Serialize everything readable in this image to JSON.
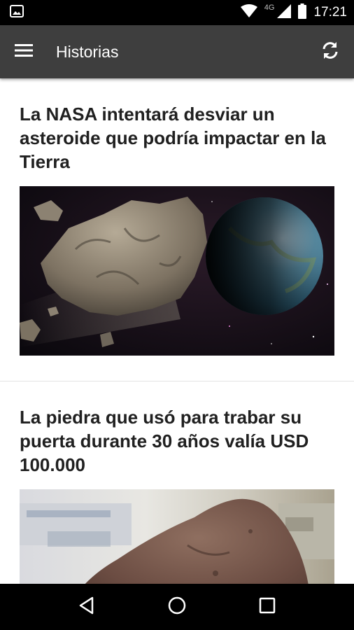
{
  "status_bar": {
    "time": "17:21",
    "network": "4G",
    "icons": [
      "image-notification-icon",
      "wifi-icon",
      "cell-signal-icon",
      "battery-icon"
    ]
  },
  "app_bar": {
    "title": "Historias",
    "menu_icon": "hamburger-menu-icon",
    "refresh_icon": "refresh-icon",
    "background": "#3e3e3e"
  },
  "articles": [
    {
      "title": "La NASA intentará desviar un asteroide que podría impactar en la Tierra",
      "image": "asteroid-and-earth-photo"
    },
    {
      "title": "La piedra que usó para trabar su puerta durante 30 años valía USD 100.000",
      "image": "meteorite-rock-photo"
    }
  ],
  "nav_bar": {
    "icons": [
      "back-icon",
      "home-icon",
      "recents-icon"
    ]
  }
}
